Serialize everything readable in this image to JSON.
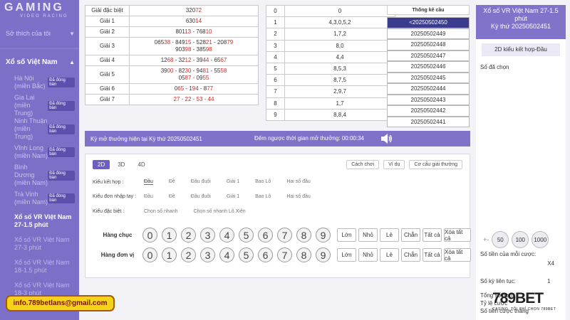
{
  "brand": {
    "title": "GAMING",
    "subtitle": "VIDEO RACING"
  },
  "sidebar": {
    "favorites_label": "Sở thích của tôi",
    "group_label": "Xổ số Việt Nam",
    "items": [
      {
        "name": "Hà Nội (miền Bắc)",
        "badge": "Đã đóng bàn"
      },
      {
        "name": "Gia Lai (miền Trung)",
        "badge": "Đã đóng bàn"
      },
      {
        "name": "Ninh Thuận (miền Trung)",
        "badge": "Đã đóng bàn"
      },
      {
        "name": "Vĩnh Long (miền Nam)",
        "badge": "Đã đóng bàn"
      },
      {
        "name": "Bình Dương (miền Nam)",
        "badge": "Đã đóng bàn"
      },
      {
        "name": "Trà Vinh (miền Nam)",
        "badge": "Đã đóng bàn"
      },
      {
        "name": "Xổ số VR Việt Nam 27-1.5 phút"
      },
      {
        "name": "Xổ số VR Việt Nam 27-3 phút"
      },
      {
        "name": "Xổ số VR Việt Nam 18-1.5 phút"
      },
      {
        "name": "Xổ số VR Việt Nam 18-3 phút"
      }
    ]
  },
  "prizes": [
    {
      "label": "Giải đặc biệt",
      "lines": [
        [
          [
            "320",
            ""
          ],
          [
            "72",
            "r"
          ]
        ]
      ]
    },
    {
      "label": "Giải 1",
      "lines": [
        [
          [
            "630",
            ""
          ],
          [
            "14",
            "r"
          ]
        ]
      ]
    },
    {
      "label": "Giải 2",
      "lines": [
        [
          [
            "801",
            ""
          ],
          [
            "13",
            "r"
          ],
          [
            " - 768",
            ""
          ],
          [
            "10",
            "r"
          ]
        ]
      ]
    },
    {
      "label": "Giải 3",
      "lines": [
        [
          [
            "065",
            ""
          ],
          [
            "38",
            "r"
          ],
          [
            " - 849",
            ""
          ],
          [
            "15",
            "r"
          ],
          [
            " - 528",
            ""
          ],
          [
            "21",
            "r"
          ],
          [
            " - 208",
            ""
          ],
          [
            "79",
            "r"
          ]
        ],
        [
          [
            "903",
            ""
          ],
          [
            "98",
            "r"
          ],
          [
            " - 385",
            ""
          ],
          [
            "98",
            "r"
          ]
        ]
      ]
    },
    {
      "label": "Giải 4",
      "lines": [
        [
          [
            "12",
            ""
          ],
          [
            "68",
            "r"
          ],
          [
            " - 32",
            ""
          ],
          [
            "12",
            "r"
          ],
          [
            " - 39",
            ""
          ],
          [
            "44",
            "r"
          ],
          [
            " - 65",
            ""
          ],
          [
            "67",
            "r"
          ]
        ]
      ]
    },
    {
      "label": "Giải 5",
      "lines": [
        [
          [
            "39",
            ""
          ],
          [
            "00",
            "r"
          ],
          [
            " - 82",
            ""
          ],
          [
            "30",
            "r"
          ],
          [
            " - 94",
            ""
          ],
          [
            "81",
            "r"
          ],
          [
            " - 55",
            ""
          ],
          [
            "58",
            "r"
          ]
        ],
        [
          [
            "05",
            ""
          ],
          [
            "87",
            "r"
          ],
          [
            " - 09",
            ""
          ],
          [
            "55",
            "r"
          ]
        ]
      ]
    },
    {
      "label": "Giải 6",
      "lines": [
        [
          [
            "0",
            ""
          ],
          [
            "65",
            "r"
          ],
          [
            " - 1",
            ""
          ],
          [
            "94",
            "r"
          ],
          [
            " - 8",
            ""
          ],
          [
            "77",
            "r"
          ]
        ]
      ]
    },
    {
      "label": "Giải 7",
      "lines": [
        [
          [
            "27 - 22 - 53 - 44",
            "r"
          ]
        ]
      ]
    }
  ],
  "heads": [
    {
      "head": "0",
      "tails": "0"
    },
    {
      "head": "1",
      "tails": "4,3,0,5,2"
    },
    {
      "head": "2",
      "tails": "1,7,2"
    },
    {
      "head": "3",
      "tails": "8,0"
    },
    {
      "head": "4",
      "tails": "4,4"
    },
    {
      "head": "5",
      "tails": "8,5,3"
    },
    {
      "head": "6",
      "tails": "8,7,5"
    },
    {
      "head": "7",
      "tails": "2,9,7"
    },
    {
      "head": "8",
      "tails": "1,7"
    },
    {
      "head": "9",
      "tails": "8,8,4"
    }
  ],
  "stats": {
    "title": "Thống kê cầu",
    "rows": [
      "<20250502450",
      "20250502449",
      "20250502448",
      "20250502447",
      "20250502446",
      "20250502445",
      "20250502444",
      "20250502443",
      "20250502442",
      "20250502441"
    ]
  },
  "notice": {
    "draw_text": "Kỳ mở thưởng hiện tại Kỳ thứ 20250502451",
    "countdown_text": "Đếm ngược thời gian mở thưởng: 00:00:34"
  },
  "bet": {
    "modes": [
      "2D",
      "3D",
      "4D"
    ],
    "top_buttons": [
      "Cách chơi",
      "Ví dụ",
      "Cơ cấu giải thưởng"
    ],
    "combo_label": "Kiểu kết hợp :",
    "combo_options": [
      "Đầu",
      "Đề",
      "Đầu đuôi",
      "Giải 1",
      "Bao Lô",
      "Hai số đầu"
    ],
    "input_label": "Kiểu đơn nhập tay :",
    "input_options": [
      "Đầu",
      "Đề",
      "Đầu đuôi",
      "Giải 1",
      "Bao Lô",
      "Hai số đầu"
    ],
    "special_label": "Kiểu đặc biệt :",
    "special_options": [
      "Chọn số nhanh",
      "Chọn số nhanh Lô Xiên"
    ],
    "rows": [
      {
        "label": "Hàng chục"
      },
      {
        "label": "Hàng đơn vị"
      }
    ],
    "digits": [
      "0",
      "1",
      "2",
      "3",
      "4",
      "5",
      "6",
      "7",
      "8",
      "9"
    ],
    "quick_buttons": [
      "Lớn",
      "Nhỏ",
      "Lẻ",
      "Chẵn",
      "Tất cả",
      "Xóa tất cả"
    ]
  },
  "right": {
    "title": "Xổ số VR Việt Nam 27-1.5 phút",
    "draw": "Kỳ thứ 20250502451",
    "mode": "2D kiểu kết hợp-Đầu",
    "chosen_label": "Số đã chọn",
    "amounts": [
      "50",
      "100",
      "1000"
    ],
    "per_bet_label": "Số tiền của mỗi cược:",
    "multiplier": "X4",
    "consecutive_label": "Số kỳ liên tục:",
    "consecutive_value": "1",
    "total_label": "Tổng số đơn",
    "ratio_label": "Tỷ lệ cược",
    "win_label": "Số tiền cược thắng"
  },
  "email": "info.789betlans@gmail.com",
  "logo": {
    "name": "789BET",
    "slogan": "CASINO, TÔI CHỈ CHỌN 789BET"
  }
}
